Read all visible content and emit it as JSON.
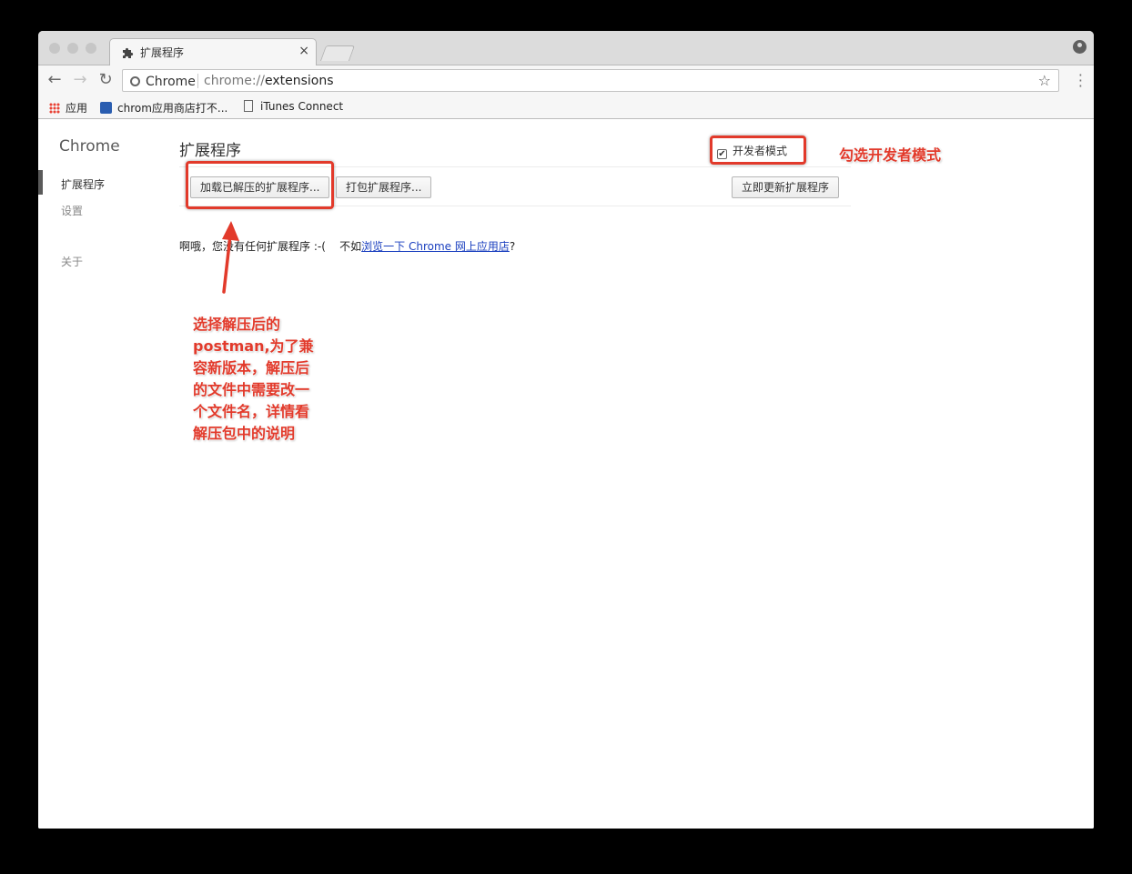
{
  "tab": {
    "title": "扩展程序",
    "close": "×"
  },
  "toolbar": {
    "back": "←",
    "forward": "→",
    "reload": "↻",
    "menu": "⋮"
  },
  "omnibox": {
    "badge": "Chrome",
    "scheme": "chrome://",
    "path": "extensions",
    "star": "☆"
  },
  "bookmarks": [
    {
      "label": "应用",
      "icon": "apps-grid-icon"
    },
    {
      "label": "chrom应用商店打不...",
      "icon": "paw-icon"
    },
    {
      "label": "iTunes Connect",
      "icon": "page-icon"
    }
  ],
  "sidebar": {
    "title": "Chrome",
    "items": [
      {
        "label": "扩展程序"
      },
      {
        "label": "设置"
      },
      {
        "label": "关于"
      }
    ]
  },
  "main": {
    "title": "扩展程序",
    "dev_mode_label": "开发者模式",
    "dev_mode_checked": true,
    "buttons": {
      "load_unpacked": "加载已解压的扩展程序...",
      "pack": "打包扩展程序...",
      "update": "立即更新扩展程序"
    },
    "empty_prefix": "啊哦，您没有任何扩展程序 :-(",
    "empty_mid": "不如",
    "empty_link": "浏览一下 Chrome 网上应用店",
    "empty_suffix": "?"
  },
  "annotations": {
    "dev_mode_note": "勾选开发者模式",
    "load_note": [
      "选择解压后的",
      "postman,为了兼",
      "容新版本，解压后",
      "的文件中需要改一",
      "个文件名，详情看",
      "解压包中的说明"
    ],
    "color": "#e23a2b"
  }
}
